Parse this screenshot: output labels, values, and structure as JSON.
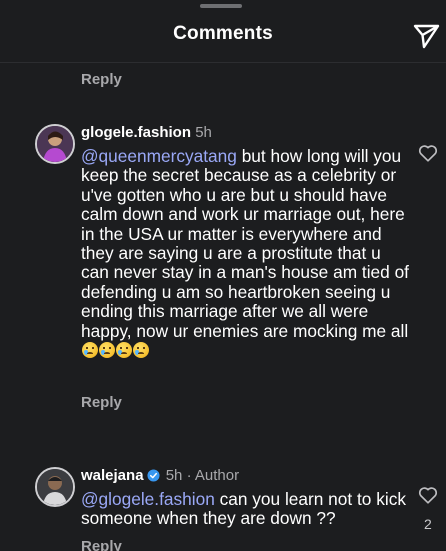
{
  "header": {
    "title": "Comments"
  },
  "top_reply": {
    "label": "Reply"
  },
  "comments": [
    {
      "username": "glogele.fashion",
      "time": "5h",
      "mention": "@queenmercyatang",
      "text": " but how long will you keep the secret because as a celebrity or u've gotten who u are but u should have calm down and work ur marriage out, here in the USA ur matter is everywhere and they are saying u are a prostitute that u can never stay in a man's house am tied of defending u am so heartbroken seeing u ending this marriage after we all were happy, now ur enemies are mocking me all",
      "emojis": [
        "crying-face",
        "crying-face",
        "crying-face",
        "crying-face"
      ],
      "reply_label": "Reply"
    },
    {
      "username": "walejana",
      "time": "5h",
      "author_tag": "· Author",
      "verified": true,
      "mention": "@glogele.fashion",
      "text": " can you learn not to kick someone when they are down ??",
      "like_count": "2",
      "reply_label": "Reply"
    }
  ],
  "colors": {
    "background": "#1c1d1f",
    "mention": "#9aa8f6",
    "muted": "#a8a8ab",
    "verified": "#3897f0"
  },
  "icons": {
    "share": "paper-plane-icon",
    "like": "heart-outline-icon",
    "verified": "verified-badge-icon"
  }
}
